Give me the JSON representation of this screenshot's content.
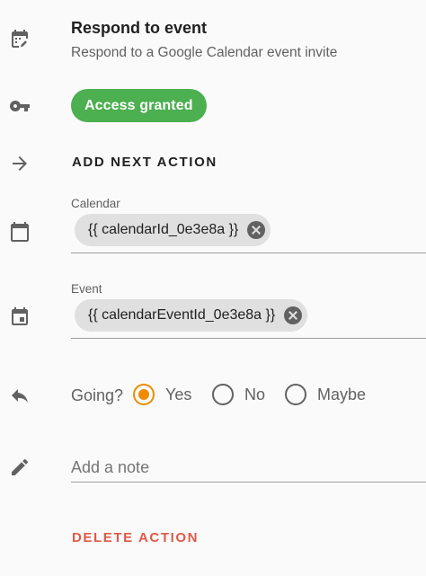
{
  "header": {
    "title": "Respond to event",
    "subtitle": "Respond to a Google Calendar event invite"
  },
  "access": {
    "label": "Access granted",
    "color": "#4caf50"
  },
  "add_next_action": "ADD NEXT ACTION",
  "calendar_field": {
    "label": "Calendar",
    "value": "{{ calendarId_0e3e8a }}"
  },
  "event_field": {
    "label": "Event",
    "value": "{{ calendarEventId_0e3e8a }}"
  },
  "going": {
    "label": "Going?",
    "options": [
      "Yes",
      "No",
      "Maybe"
    ],
    "selected": "Yes",
    "accent_color": "#ef8b00"
  },
  "note": {
    "placeholder": "Add a note"
  },
  "delete_action": "DELETE ACTION",
  "icons": [
    "calendar-edit-icon",
    "key-icon",
    "arrow-right-icon",
    "calendar-icon",
    "event-icon",
    "reply-icon",
    "pencil-icon"
  ]
}
